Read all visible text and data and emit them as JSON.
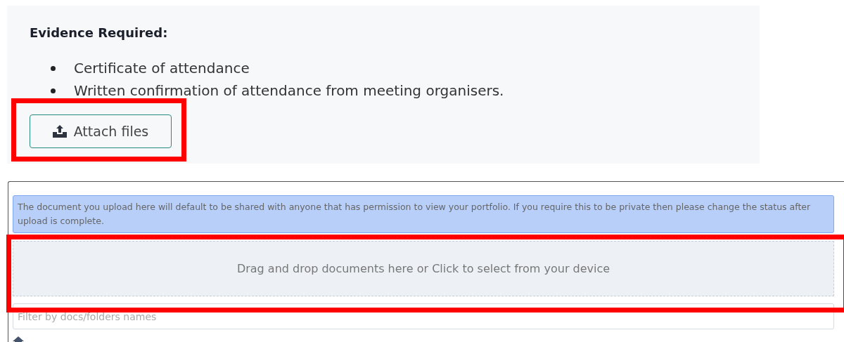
{
  "evidence": {
    "heading": "Evidence Required:",
    "items": [
      "Certificate of attendance",
      "Written confirmation of attendance from meeting organisers."
    ],
    "attach_button": "Attach files"
  },
  "upload": {
    "notice": "The document you upload here will default to be shared with anyone that has permission to view your portfolio. If you require this to be private then please change the status after upload is complete.",
    "dropzone": "Drag and drop documents here or Click to select from your device",
    "filter": {
      "placeholder": "Filter by docs/folders names"
    }
  }
}
